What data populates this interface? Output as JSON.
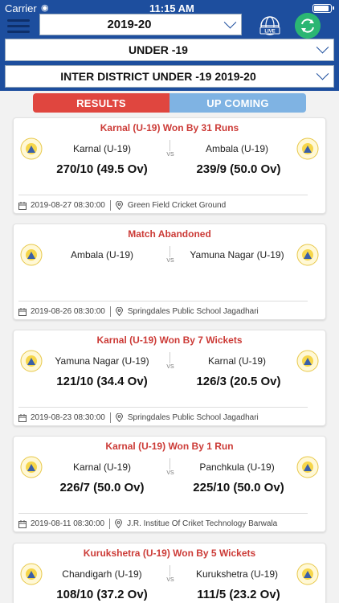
{
  "status_bar": {
    "carrier": "Carrier",
    "time": "11:15 AM"
  },
  "header": {
    "season": "2019-20",
    "age_group": "UNDER -19",
    "tournament": "INTER DISTRICT UNDER -19 2019-20",
    "live_label": "LIVE"
  },
  "tabs": {
    "results": "RESULTS",
    "upcoming": "UP COMING"
  },
  "matches": [
    {
      "result": "Karnal (U-19) Won By 31 Runs",
      "team1": "Karnal (U-19)",
      "team2": "Ambala (U-19)",
      "score1": "270/10 (49.5 Ov)",
      "score2": "239/9 (50.0 Ov)",
      "vs": "VS",
      "datetime": "2019-08-27 08:30:00",
      "venue": "Green Field Cricket Ground"
    },
    {
      "result": "Match Abandoned",
      "team1": "Ambala (U-19)",
      "team2": "Yamuna Nagar (U-19)",
      "score1": "",
      "score2": "",
      "vs": "VS",
      "datetime": "2019-08-26 08:30:00",
      "venue": "Springdales Public School Jagadhari"
    },
    {
      "result": "Karnal (U-19) Won By 7 Wickets",
      "team1": "Yamuna Nagar (U-19)",
      "team2": "Karnal (U-19)",
      "score1": "121/10 (34.4 Ov)",
      "score2": "126/3 (20.5 Ov)",
      "vs": "VS",
      "datetime": "2019-08-23 08:30:00",
      "venue": "Springdales Public School Jagadhari"
    },
    {
      "result": "Karnal (U-19) Won By 1 Run",
      "team1": "Karnal (U-19)",
      "team2": "Panchkula (U-19)",
      "score1": "226/7 (50.0 Ov)",
      "score2": "225/10 (50.0 Ov)",
      "vs": "VS",
      "datetime": "2019-08-11 08:30:00",
      "venue": "J.R. Institue Of Criket Technology Barwala"
    },
    {
      "result": "Kurukshetra (U-19) Won By 5 Wickets",
      "team1": "Chandigarh (U-19)",
      "team2": "Kurukshetra (U-19)",
      "score1": "108/10 (37.2 Ov)",
      "score2": "111/5 (23.2 Ov)",
      "vs": "VS",
      "datetime": "",
      "venue": ""
    }
  ],
  "colors": {
    "header_bg": "#1d4e9e",
    "results_tab": "#e0463f",
    "upcoming_tab": "#7fb3e3",
    "result_text": "#cc3b37",
    "refresh": "#2bb673"
  }
}
